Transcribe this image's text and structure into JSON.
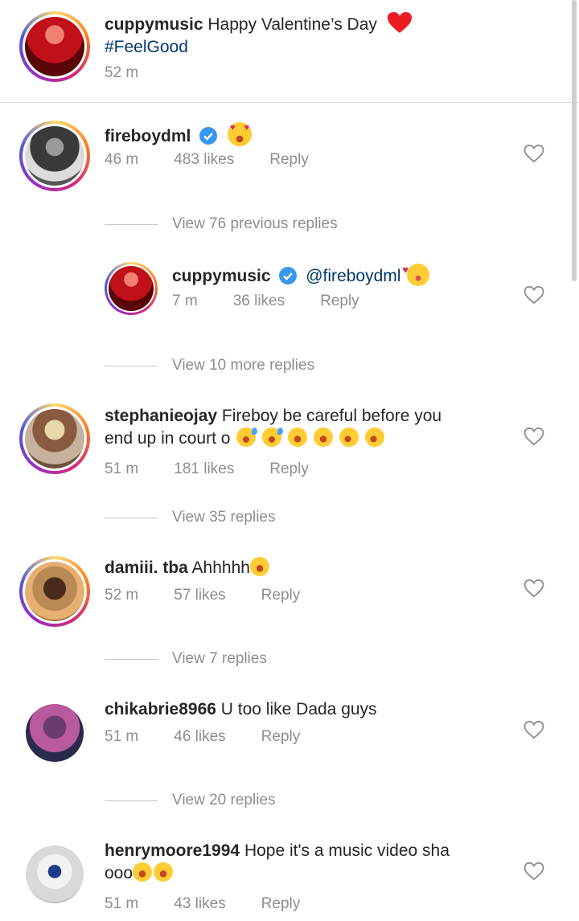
{
  "caption": {
    "username": "cuppymusic",
    "text": "Happy Valentine’s Day",
    "emoji": "red-heart",
    "hashtag": "#FeelGood",
    "time": "52 m"
  },
  "comments": [
    {
      "username": "fireboydml",
      "verified": true,
      "text": "",
      "emojis": [
        "heart-eyes"
      ],
      "time": "46 m",
      "likes": "483 likes",
      "reply_label": "Reply",
      "view_replies": "View 76 previous replies",
      "reply": {
        "username": "cuppymusic",
        "verified": true,
        "mention": "@fireboydml",
        "emojis": [
          "smiling-face-with-hearts"
        ],
        "time": "7 m",
        "likes": "36 likes",
        "reply_label": "Reply"
      },
      "view_more": "View 10 more replies"
    },
    {
      "username": "stephanieojay",
      "text_line1": "Fireboy be careful before you",
      "text_line2": "end up in court o",
      "emojis": [
        "sweat-smile",
        "sweat-smile",
        "joy",
        "joy",
        "rofl",
        "rofl"
      ],
      "time": "51 m",
      "likes": "181 likes",
      "reply_label": "Reply",
      "view_replies": "View 35 replies"
    },
    {
      "username": "damiii. tba",
      "text": "Ahhhhh",
      "emojis": [
        "joy"
      ],
      "time": "52 m",
      "likes": "57 likes",
      "reply_label": "Reply",
      "view_replies": "View 7 replies"
    },
    {
      "username": "chikabrie8966",
      "text": "U too like Dada guys",
      "time": "51 m",
      "likes": "46 likes",
      "reply_label": "Reply",
      "view_replies": "View 20 replies"
    },
    {
      "username": "henrymoore1994",
      "text_line1": "Hope it's a music video sha",
      "text_line2": "ooo",
      "emojis": [
        "joy",
        "joy"
      ],
      "time": "51 m",
      "likes": "43 likes",
      "reply_label": "Reply"
    }
  ],
  "colors": {
    "link": "#00376b",
    "muted": "#8e8e8e",
    "verified": "#3897f0",
    "heart": "#ed1c24"
  }
}
